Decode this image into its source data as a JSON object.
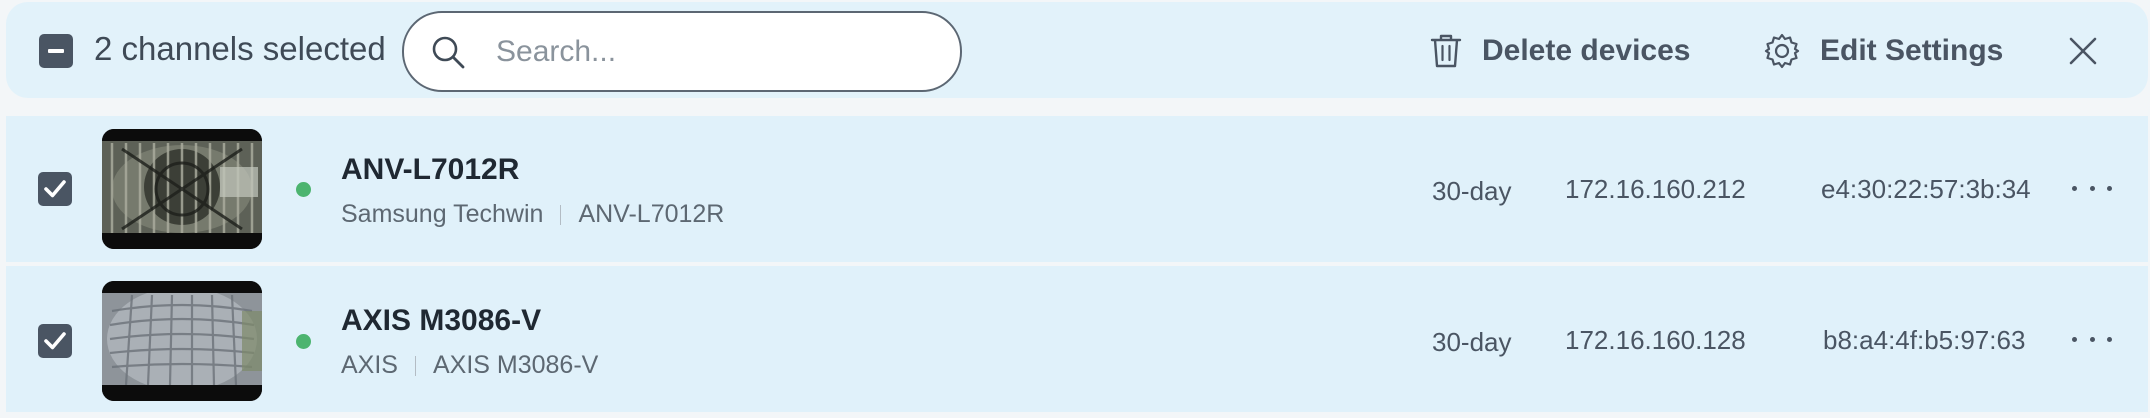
{
  "toolbar": {
    "selection_label": "2 channels selected",
    "search_placeholder": "Search...",
    "search_value": "",
    "delete_label": "Delete devices",
    "edit_label": "Edit Settings"
  },
  "devices": [
    {
      "name": "ANV-L7012R",
      "manufacturer": "Samsung Techwin",
      "model": "ANV-L7012R",
      "retention": "30-day",
      "ip": "172.16.160.212",
      "mac": "e4:30:22:57:3b:34",
      "status": "online",
      "selected": true
    },
    {
      "name": "AXIS M3086-V",
      "manufacturer": "AXIS",
      "model": "AXIS M3086-V",
      "retention": "30-day",
      "ip": "172.16.160.128",
      "mac": "b8:a4:4f:b5:97:63",
      "status": "online",
      "selected": true
    }
  ],
  "colors": {
    "toolbar_bg": "#e2f2fa",
    "row_bg": "#e0f1fa",
    "checkbox": "#4a5563",
    "status_online": "#4cb46f"
  },
  "icons": [
    "indeterminate-checkbox",
    "search-icon",
    "trash-icon",
    "gear-icon",
    "close-icon",
    "checkbox-checked-icon",
    "more-horizontal-icon"
  ]
}
